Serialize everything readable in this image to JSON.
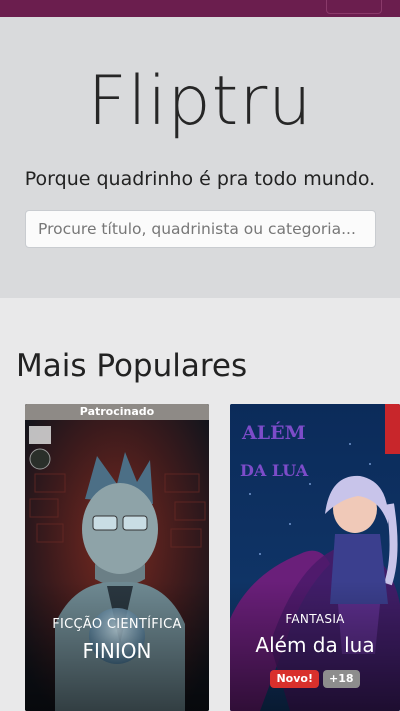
{
  "header": {
    "menu_icon": "hamburger-menu-icon"
  },
  "hero": {
    "brand": "Fliptru",
    "tagline": "Porque quadrinho é pra todo mundo.",
    "search_placeholder": "Procure título, quadrinista ou categoria..."
  },
  "popular": {
    "title": "Mais Populares",
    "items": [
      {
        "sponsor_label": "Patrocinado",
        "cover_text": "FINION",
        "category": "FICÇÃO CIENTÍFICA",
        "title": "FINION"
      },
      {
        "cover_text_line1": "ALÉM",
        "cover_text_line2": "DA LUA",
        "category": "FANTASIA",
        "title": "Além da lua",
        "badges": [
          "Novo!",
          "+18"
        ]
      }
    ]
  },
  "colors": {
    "topbar": "#6b1e4e",
    "hero_bg": "#d9dadc",
    "page_bg": "#e9e9ea",
    "badge_new": "#d9302c",
    "badge_age": "#8d8d8d"
  }
}
